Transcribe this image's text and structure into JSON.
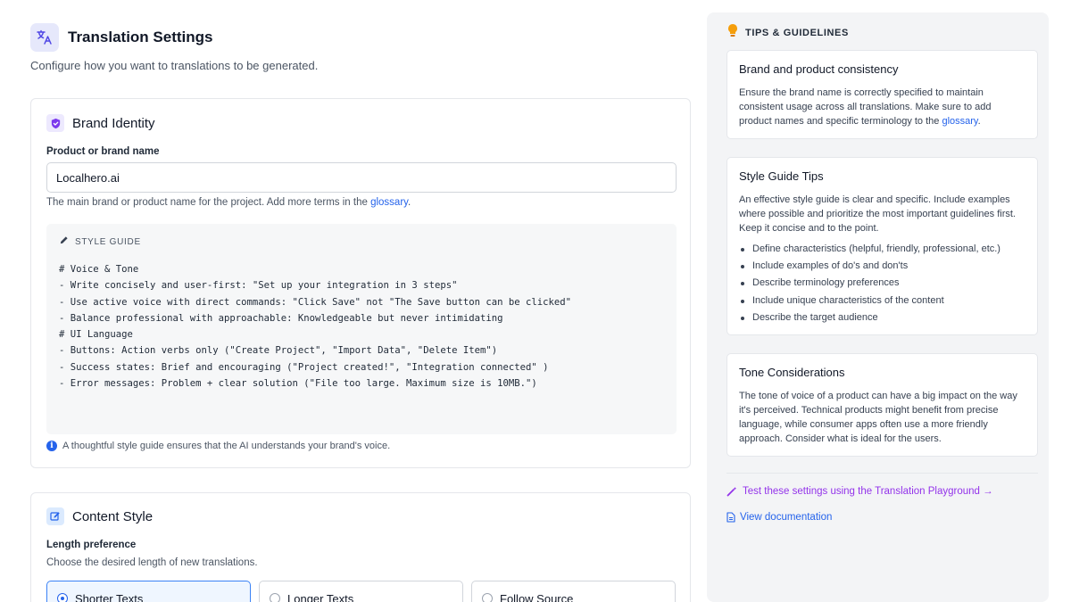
{
  "header": {
    "icon": "translate-icon",
    "title": "Translation Settings",
    "subtitle": "Configure how you want to translations to be generated."
  },
  "brand": {
    "icon": "shield-icon",
    "title": "Brand Identity",
    "product_label": "Product or brand name",
    "product_value": "Localhero.ai",
    "help_text": "The main brand or product name for the project. Add more terms in the",
    "help_link": "glossary",
    "help_tail": ".",
    "style_guide": {
      "icon": "pencil-icon",
      "label": "STYLE GUIDE",
      "lines": [
        "# Voice & Tone",
        "- Write concisely and user-first: \"Set up your integration in 3 steps\"",
        "- Use active voice with direct commands: \"Click Save\" not \"The Save button can be clicked\"",
        "- Balance professional with approachable: Knowledgeable but never intimidating",
        "# UI Language",
        "- Buttons: Action verbs only (\"Create Project\", \"Import Data\", \"Delete Item\")",
        "- Success states: Brief and encouraging (\"Project created!\", \"Integration connected\" )",
        "- Error messages: Problem + clear solution (\"File too large. Maximum size is 10MB.\")"
      ]
    },
    "info_icon": "info-icon",
    "info_text": "A thoughtful style guide ensures that the AI understands your brand's voice."
  },
  "content_style": {
    "icon": "edit-icon",
    "title": "Content Style",
    "length_label": "Length preference",
    "length_help": "Choose the desired length of new translations.",
    "options": [
      {
        "label": "Shorter Texts",
        "selected": true
      },
      {
        "label": "Longer Texts",
        "selected": false
      },
      {
        "label": "Follow Source",
        "selected": false
      }
    ]
  },
  "tips": {
    "icon": "lightbulb-icon",
    "heading": "TIPS & GUIDELINES",
    "brand": {
      "title": "Brand and product consistency",
      "body": "Ensure the brand name is correctly specified to maintain consistent usage across all translations. Make sure to add product names and specific terminology to the",
      "link": "glossary",
      "tail": "."
    },
    "style": {
      "title": "Style Guide Tips",
      "body": "An effective style guide is clear and specific. Include examples where possible and prioritize the most important guidelines first. Keep it concise and to the point.",
      "items": [
        "Define characteristics (helpful, friendly, professional, etc.)",
        "Include examples of do's and don'ts",
        "Describe terminology preferences",
        "Include unique characteristics of the content",
        "Describe the target audience"
      ]
    },
    "tone": {
      "title": "Tone Considerations",
      "body": "The tone of voice of a product can have a big impact on the way it's perceived. Technical products might benefit from precise language, while consumer apps often use a more friendly approach. Consider what is ideal for the users."
    },
    "playground_link": "Test these settings using the Translation Playground →",
    "playground_icon": "wand-icon",
    "docs_link": "View documentation",
    "docs_icon": "document-icon"
  },
  "colors": {
    "accent_purple": "#9333ea",
    "link_blue": "#2563eb",
    "selected_bg": "#eff6ff"
  }
}
